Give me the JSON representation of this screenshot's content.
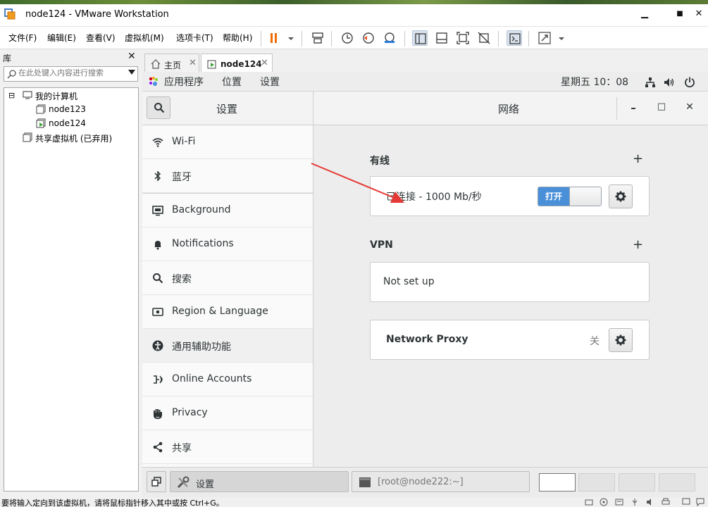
{
  "window": {
    "title": "node124 - VMware Workstation",
    "minimize": "▁",
    "maximize": "■",
    "close": "✕"
  },
  "menu": [
    "文件(F)",
    "编辑(E)",
    "查看(V)",
    "虚拟机(M)",
    "选项卡(T)",
    "帮助(H)"
  ],
  "library": {
    "title": "库",
    "close": "✕",
    "search_placeholder": "在此处键入内容进行搜索",
    "tree": [
      {
        "label": "我的计算机",
        "toggle": "⊟"
      },
      {
        "label": "node123"
      },
      {
        "label": "node124"
      },
      {
        "label": "共享虚拟机 (已弃用)"
      }
    ]
  },
  "tabs": [
    {
      "label": "主页",
      "close": "✕"
    },
    {
      "label": "node124",
      "close": "✕"
    }
  ],
  "gnome_topbar": {
    "apps": "应用程序",
    "places": "位置",
    "settings": "设置",
    "clock": "星期五 10：08"
  },
  "settings": {
    "left_title": "设置",
    "right_title": "网络",
    "min": "–",
    "max": "□",
    "close": "✕",
    "sidebar": [
      {
        "label": "Wi-Fi",
        "icon": "wifi-icon"
      },
      {
        "label": "蓝牙",
        "icon": "bluetooth-icon"
      },
      {
        "label": "Background",
        "icon": "background-icon"
      },
      {
        "label": "Notifications",
        "icon": "bell-icon"
      },
      {
        "label": "搜索",
        "icon": "search-icon"
      },
      {
        "label": "Region & Language",
        "icon": "region-icon"
      },
      {
        "label": "通用辅助功能",
        "icon": "accessibility-icon"
      },
      {
        "label": "Online Accounts",
        "icon": "online-accounts-icon"
      },
      {
        "label": "Privacy",
        "icon": "privacy-hand-icon"
      },
      {
        "label": "共享",
        "icon": "share-icon"
      }
    ],
    "wired": {
      "title": "有线",
      "add": "+",
      "status": "已连接 - 1000 Mb/秒",
      "switch_label": "打开"
    },
    "vpn": {
      "title": "VPN",
      "add": "+",
      "status": "Not set up"
    },
    "proxy": {
      "title": "Network Proxy",
      "state": "关"
    }
  },
  "taskbar": {
    "settings_label": "设置",
    "terminal_label": "[root@node222:~]"
  },
  "status": {
    "message": "要将输入定向到该虚拟机，请将鼠标指针移入其中或按 Ctrl+G。"
  },
  "colors": {
    "accent": "#4a90d9",
    "annotation_arrow": "#e53935",
    "pause": "#ef6c00"
  }
}
